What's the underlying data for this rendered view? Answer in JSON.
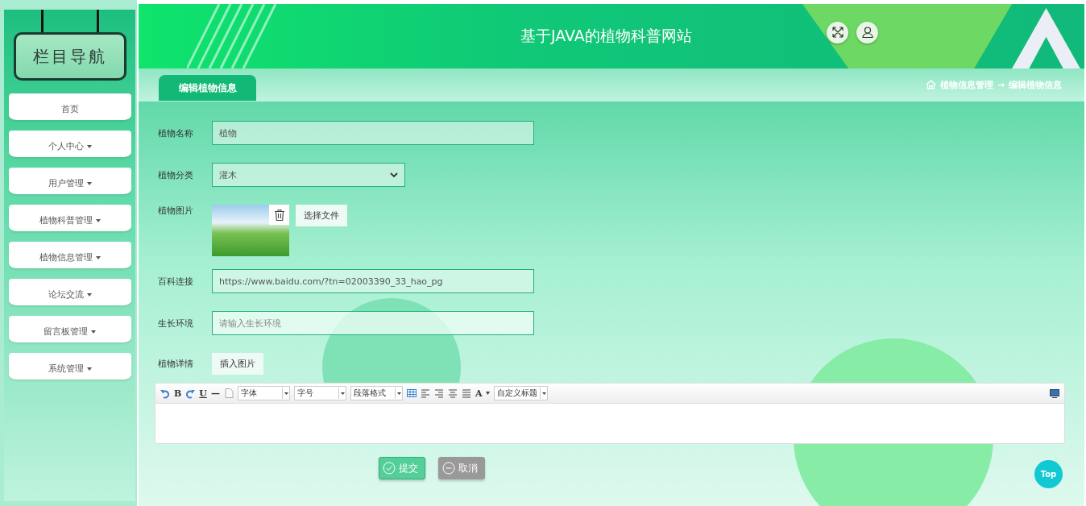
{
  "sidebar": {
    "title": "栏目导航",
    "items": [
      {
        "label": "首页",
        "has_submenu": false
      },
      {
        "label": "个人中心",
        "has_submenu": true
      },
      {
        "label": "用户管理",
        "has_submenu": true
      },
      {
        "label": "植物科普管理",
        "has_submenu": true
      },
      {
        "label": "植物信息管理",
        "has_submenu": true
      },
      {
        "label": "论坛交流",
        "has_submenu": true
      },
      {
        "label": "留言板管理",
        "has_submenu": true
      },
      {
        "label": "系统管理",
        "has_submenu": true
      }
    ]
  },
  "header": {
    "title": "基于JAVA的植物科普网站"
  },
  "tabs": [
    {
      "label": "编辑植物信息",
      "selected": true
    }
  ],
  "breadcrumb": {
    "items": [
      "植物信息管理",
      "编辑植物信息"
    ],
    "separator": "→"
  },
  "form": {
    "fields": [
      {
        "kind": "text",
        "label": "植物名称",
        "value": "植物"
      },
      {
        "kind": "select",
        "label": "植物分类",
        "value": "灌木"
      },
      {
        "kind": "image",
        "label": "植物图片",
        "button": "选择文件"
      },
      {
        "kind": "text",
        "label": "百科连接",
        "value": "https://www.baidu.com/?tn=02003390_33_hao_pg"
      },
      {
        "kind": "text",
        "label": "生长环境",
        "placeholder": "请输入生长环境"
      },
      {
        "kind": "editor",
        "label": "植物详情",
        "button": "插入图片"
      }
    ]
  },
  "editor_toolbar": [
    {
      "kind": "undo"
    },
    {
      "kind": "glyph",
      "text": "B"
    },
    {
      "kind": "redo"
    },
    {
      "kind": "glyph",
      "text": "U"
    },
    {
      "kind": "glyph",
      "text": "—"
    },
    {
      "kind": "page"
    },
    {
      "kind": "select",
      "text": "字体"
    },
    {
      "kind": "select",
      "text": "字号"
    },
    {
      "kind": "select",
      "text": "段落格式"
    },
    {
      "kind": "table"
    },
    {
      "kind": "align-left"
    },
    {
      "kind": "align-right"
    },
    {
      "kind": "align-center"
    },
    {
      "kind": "justify"
    },
    {
      "kind": "glyph-menu",
      "text": "A"
    },
    {
      "kind": "select",
      "text": "自定义标题"
    }
  ],
  "buttons": [
    {
      "kind": "submit",
      "label": "提交"
    },
    {
      "kind": "cancel",
      "label": "取消"
    }
  ],
  "top_button": "Top"
}
